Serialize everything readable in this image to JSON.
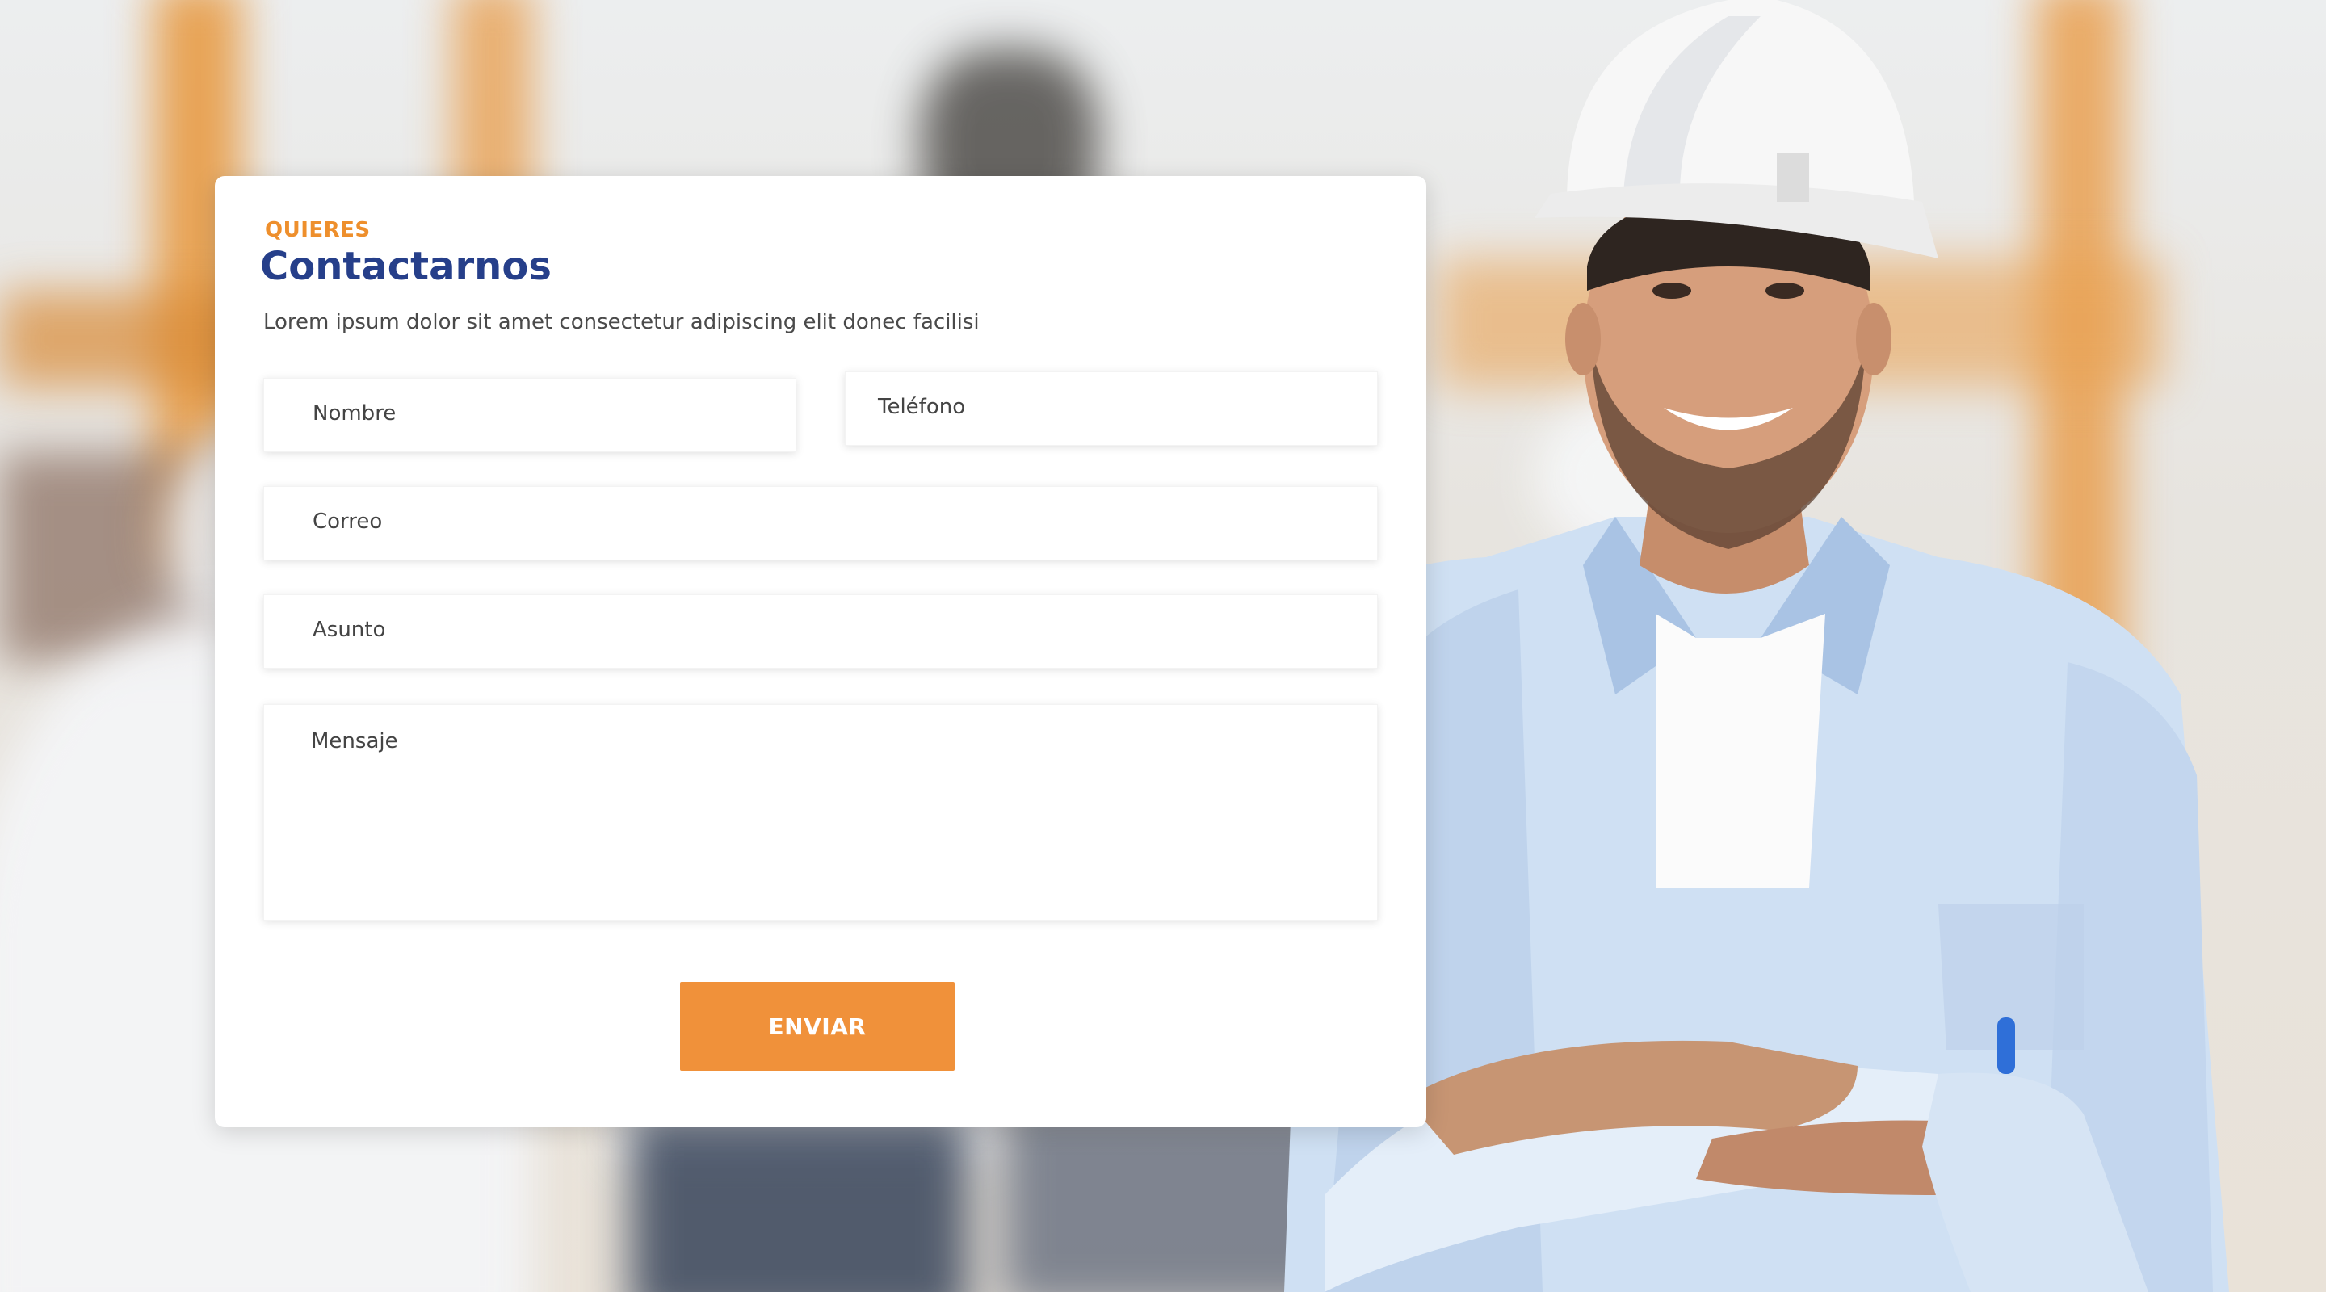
{
  "contact": {
    "eyebrow": "QUIERES",
    "title": "Contactarnos",
    "subtitle": "Lorem ipsum dolor sit amet consectetur adipiscing elit donec facilisi",
    "fields": {
      "nombre": {
        "placeholder": "Nombre"
      },
      "telefono": {
        "placeholder": "Teléfono"
      },
      "correo": {
        "placeholder": "Correo"
      },
      "asunto": {
        "placeholder": "Asunto"
      },
      "mensaje": {
        "placeholder": "Mensaje"
      }
    },
    "submit_label": "ENVIAR"
  },
  "colors": {
    "accent": "#f0913a",
    "title": "#263f8a",
    "eyebrow": "#ee8f2c"
  },
  "background": {
    "image": "construction-worker-photo"
  }
}
